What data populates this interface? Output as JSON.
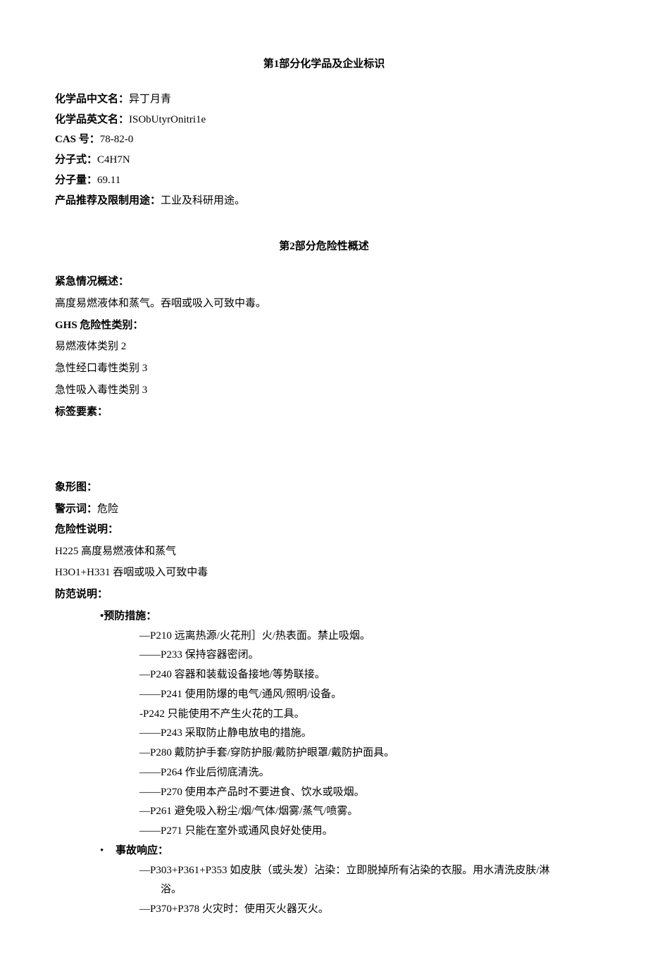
{
  "section1": {
    "title": "第1部分化学品及企业标识",
    "fields": {
      "name_cn_label": "化学品中文名：",
      "name_cn_value": "异丁月青",
      "name_en_label": "化学品英文名：",
      "name_en_value": "ISObUtyrOnitri1e",
      "cas_label": "CAS 号：",
      "cas_value": "78-82-0",
      "formula_label": "分子式：",
      "formula_value": "C4H7N",
      "mw_label": "分子量：",
      "mw_value": "69.11",
      "use_label": "产品推荐及限制用途：",
      "use_value": "工业及科研用途。"
    }
  },
  "section2": {
    "title": "第2部分危险性概述",
    "emergency_label": "紧急情况概述：",
    "emergency_text": "高度易燃液体和蒸气。吞咽或吸入可致中毒。",
    "ghs_label": "GHS 危险性类别：",
    "ghs_lines": [
      "易燃液体类别 2",
      "急性经口毒性类别 3",
      "急性吸入毒性类别 3"
    ],
    "label_elements": "标签要素：",
    "pictogram_label": "象形图：",
    "signal_label": "警示词：",
    "signal_value": "危险",
    "hazard_label": "危险性说明：",
    "hazard_lines": [
      "H225 高度易燃液体和蒸气",
      "H3O1+H331 吞咽或吸入可致中毒"
    ],
    "precaution_label": "防范说明：",
    "prevention_head": "•预防措施：",
    "prevention_items": [
      {
        "dash": "dash-1",
        "text": "P210 远离热源/火花刑］火/热表面。禁止吸烟。"
      },
      {
        "dash": "dash-long",
        "text": "P233 保持容器密闭。"
      },
      {
        "dash": "dash-1",
        "text": "P240 容器和装载设备接地/等势联接。"
      },
      {
        "dash": "dash-long",
        "text": "P241 使用防爆的电气/通风/照明/设备。"
      },
      {
        "dash": "dash-hyphen",
        "text": "P242 只能使用不产生火花的工具。"
      },
      {
        "dash": "dash-long",
        "text": "P243 采取防止静电放电的措施。"
      },
      {
        "dash": "dash-1",
        "text": "P280 戴防护手套/穿防护服/戴防护眼罩/戴防护面具。"
      },
      {
        "dash": "dash-long",
        "text": "P264 作业后彻底清洗。"
      },
      {
        "dash": "dash-long",
        "text": "P270 使用本产品时不要进食、饮水或吸烟。"
      },
      {
        "dash": "dash-1",
        "text": "P261 避免吸入粉尘/烟/气体/烟雾/蒸气/喷雾。"
      },
      {
        "dash": "dash-long",
        "text": "P271 只能在室外或通风良好处使用。"
      }
    ],
    "response_head": "事故响应：",
    "response_items": [
      {
        "dash": "dash-1",
        "text": "P303+P361+P353 如皮肤（或头发）沾染：立即脱掉所有沾染的衣服。用水清洗皮肤/淋",
        "cont": "浴。"
      },
      {
        "dash": "dash-1",
        "text": "P370+P378 火灾时：使用灭火器灭火。"
      }
    ]
  }
}
